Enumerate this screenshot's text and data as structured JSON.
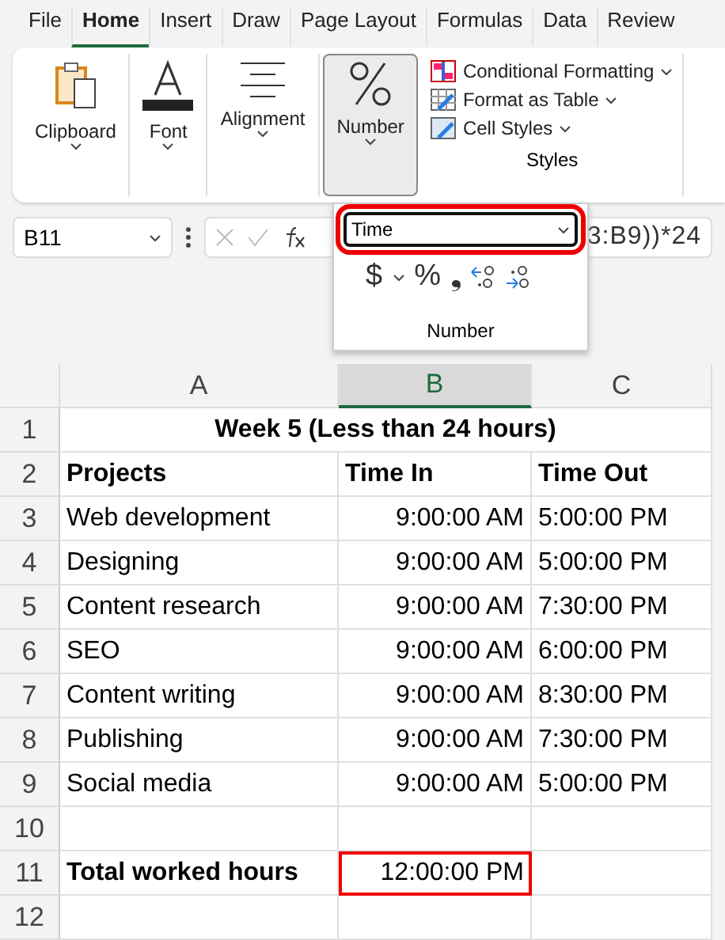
{
  "tabs": [
    {
      "label": "File",
      "selected": false
    },
    {
      "label": "Home",
      "selected": true
    },
    {
      "label": "Insert",
      "selected": false
    },
    {
      "label": "Draw",
      "selected": false
    },
    {
      "label": "Page Layout",
      "selected": false
    },
    {
      "label": "Formulas",
      "selected": false
    },
    {
      "label": "Data",
      "selected": false
    },
    {
      "label": "Review",
      "selected": false
    }
  ],
  "ribbon": {
    "groups": [
      {
        "kind": "clipboard",
        "label": "Clipboard",
        "pressed": false
      },
      {
        "kind": "font",
        "label": "Font",
        "pressed": false
      },
      {
        "kind": "alignment",
        "label": "Alignment",
        "pressed": false
      },
      {
        "kind": "number",
        "label": "Number",
        "pressed": true
      }
    ],
    "styles": {
      "items": [
        {
          "kind": "conditional",
          "label": "Conditional Formatting"
        },
        {
          "kind": "table",
          "label": "Format as Table"
        },
        {
          "kind": "cellstyles",
          "label": "Cell Styles"
        }
      ],
      "label": "Styles"
    }
  },
  "number_popup": {
    "format": "Time",
    "symbols": [
      "$",
      "%",
      "❟"
    ],
    "label": "Number"
  },
  "formula_bar": {
    "name_box": "B11",
    "formula": "3:B9))*24"
  },
  "sheet": {
    "columns": [
      {
        "label": "A",
        "selected": false
      },
      {
        "label": "B",
        "selected": true
      },
      {
        "label": "C",
        "selected": false
      }
    ],
    "rows": [
      {
        "number": "1",
        "kind": "title",
        "cells": [
          "Week 5 (Less than 24 hours)"
        ]
      },
      {
        "number": "2",
        "kind": "header",
        "cells": [
          "Projects",
          "Time In",
          "Time Out"
        ]
      },
      {
        "number": "3",
        "kind": "data",
        "cells": [
          "Web development",
          "9:00:00 AM",
          "5:00:00 PM"
        ]
      },
      {
        "number": "4",
        "kind": "data",
        "cells": [
          "Designing",
          "9:00:00 AM",
          "5:00:00 PM"
        ]
      },
      {
        "number": "5",
        "kind": "data",
        "cells": [
          "Content research",
          "9:00:00 AM",
          "7:30:00 PM"
        ]
      },
      {
        "number": "6",
        "kind": "data",
        "cells": [
          "SEO",
          "9:00:00 AM",
          "6:00:00 PM"
        ]
      },
      {
        "number": "7",
        "kind": "data",
        "cells": [
          "Content writing",
          "9:00:00 AM",
          "8:30:00 PM"
        ]
      },
      {
        "number": "8",
        "kind": "data",
        "cells": [
          "Publishing",
          "9:00:00 AM",
          "7:30:00 PM"
        ]
      },
      {
        "number": "9",
        "kind": "data",
        "cells": [
          "Social media",
          "9:00:00 AM",
          "5:00:00 PM"
        ]
      },
      {
        "number": "10",
        "kind": "blank",
        "cells": []
      },
      {
        "number": "11",
        "kind": "total",
        "cells": [
          "Total worked hours",
          "12:00:00 PM"
        ],
        "selected_cells": [
          false,
          true
        ]
      },
      {
        "number": "12",
        "kind": "blank",
        "cells": []
      }
    ]
  }
}
